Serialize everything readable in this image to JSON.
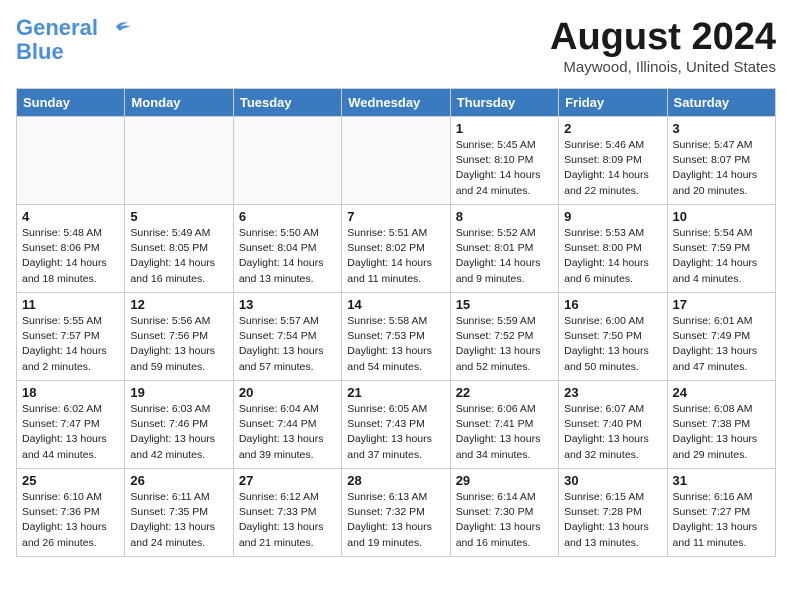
{
  "header": {
    "logo_line1": "General",
    "logo_line2": "Blue",
    "month_year": "August 2024",
    "location": "Maywood, Illinois, United States"
  },
  "days_of_week": [
    "Sunday",
    "Monday",
    "Tuesday",
    "Wednesday",
    "Thursday",
    "Friday",
    "Saturday"
  ],
  "weeks": [
    [
      {
        "day": "",
        "info": ""
      },
      {
        "day": "",
        "info": ""
      },
      {
        "day": "",
        "info": ""
      },
      {
        "day": "",
        "info": ""
      },
      {
        "day": "1",
        "info": "Sunrise: 5:45 AM\nSunset: 8:10 PM\nDaylight: 14 hours\nand 24 minutes."
      },
      {
        "day": "2",
        "info": "Sunrise: 5:46 AM\nSunset: 8:09 PM\nDaylight: 14 hours\nand 22 minutes."
      },
      {
        "day": "3",
        "info": "Sunrise: 5:47 AM\nSunset: 8:07 PM\nDaylight: 14 hours\nand 20 minutes."
      }
    ],
    [
      {
        "day": "4",
        "info": "Sunrise: 5:48 AM\nSunset: 8:06 PM\nDaylight: 14 hours\nand 18 minutes."
      },
      {
        "day": "5",
        "info": "Sunrise: 5:49 AM\nSunset: 8:05 PM\nDaylight: 14 hours\nand 16 minutes."
      },
      {
        "day": "6",
        "info": "Sunrise: 5:50 AM\nSunset: 8:04 PM\nDaylight: 14 hours\nand 13 minutes."
      },
      {
        "day": "7",
        "info": "Sunrise: 5:51 AM\nSunset: 8:02 PM\nDaylight: 14 hours\nand 11 minutes."
      },
      {
        "day": "8",
        "info": "Sunrise: 5:52 AM\nSunset: 8:01 PM\nDaylight: 14 hours\nand 9 minutes."
      },
      {
        "day": "9",
        "info": "Sunrise: 5:53 AM\nSunset: 8:00 PM\nDaylight: 14 hours\nand 6 minutes."
      },
      {
        "day": "10",
        "info": "Sunrise: 5:54 AM\nSunset: 7:59 PM\nDaylight: 14 hours\nand 4 minutes."
      }
    ],
    [
      {
        "day": "11",
        "info": "Sunrise: 5:55 AM\nSunset: 7:57 PM\nDaylight: 14 hours\nand 2 minutes."
      },
      {
        "day": "12",
        "info": "Sunrise: 5:56 AM\nSunset: 7:56 PM\nDaylight: 13 hours\nand 59 minutes."
      },
      {
        "day": "13",
        "info": "Sunrise: 5:57 AM\nSunset: 7:54 PM\nDaylight: 13 hours\nand 57 minutes."
      },
      {
        "day": "14",
        "info": "Sunrise: 5:58 AM\nSunset: 7:53 PM\nDaylight: 13 hours\nand 54 minutes."
      },
      {
        "day": "15",
        "info": "Sunrise: 5:59 AM\nSunset: 7:52 PM\nDaylight: 13 hours\nand 52 minutes."
      },
      {
        "day": "16",
        "info": "Sunrise: 6:00 AM\nSunset: 7:50 PM\nDaylight: 13 hours\nand 50 minutes."
      },
      {
        "day": "17",
        "info": "Sunrise: 6:01 AM\nSunset: 7:49 PM\nDaylight: 13 hours\nand 47 minutes."
      }
    ],
    [
      {
        "day": "18",
        "info": "Sunrise: 6:02 AM\nSunset: 7:47 PM\nDaylight: 13 hours\nand 44 minutes."
      },
      {
        "day": "19",
        "info": "Sunrise: 6:03 AM\nSunset: 7:46 PM\nDaylight: 13 hours\nand 42 minutes."
      },
      {
        "day": "20",
        "info": "Sunrise: 6:04 AM\nSunset: 7:44 PM\nDaylight: 13 hours\nand 39 minutes."
      },
      {
        "day": "21",
        "info": "Sunrise: 6:05 AM\nSunset: 7:43 PM\nDaylight: 13 hours\nand 37 minutes."
      },
      {
        "day": "22",
        "info": "Sunrise: 6:06 AM\nSunset: 7:41 PM\nDaylight: 13 hours\nand 34 minutes."
      },
      {
        "day": "23",
        "info": "Sunrise: 6:07 AM\nSunset: 7:40 PM\nDaylight: 13 hours\nand 32 minutes."
      },
      {
        "day": "24",
        "info": "Sunrise: 6:08 AM\nSunset: 7:38 PM\nDaylight: 13 hours\nand 29 minutes."
      }
    ],
    [
      {
        "day": "25",
        "info": "Sunrise: 6:10 AM\nSunset: 7:36 PM\nDaylight: 13 hours\nand 26 minutes."
      },
      {
        "day": "26",
        "info": "Sunrise: 6:11 AM\nSunset: 7:35 PM\nDaylight: 13 hours\nand 24 minutes."
      },
      {
        "day": "27",
        "info": "Sunrise: 6:12 AM\nSunset: 7:33 PM\nDaylight: 13 hours\nand 21 minutes."
      },
      {
        "day": "28",
        "info": "Sunrise: 6:13 AM\nSunset: 7:32 PM\nDaylight: 13 hours\nand 19 minutes."
      },
      {
        "day": "29",
        "info": "Sunrise: 6:14 AM\nSunset: 7:30 PM\nDaylight: 13 hours\nand 16 minutes."
      },
      {
        "day": "30",
        "info": "Sunrise: 6:15 AM\nSunset: 7:28 PM\nDaylight: 13 hours\nand 13 minutes."
      },
      {
        "day": "31",
        "info": "Sunrise: 6:16 AM\nSunset: 7:27 PM\nDaylight: 13 hours\nand 11 minutes."
      }
    ]
  ]
}
